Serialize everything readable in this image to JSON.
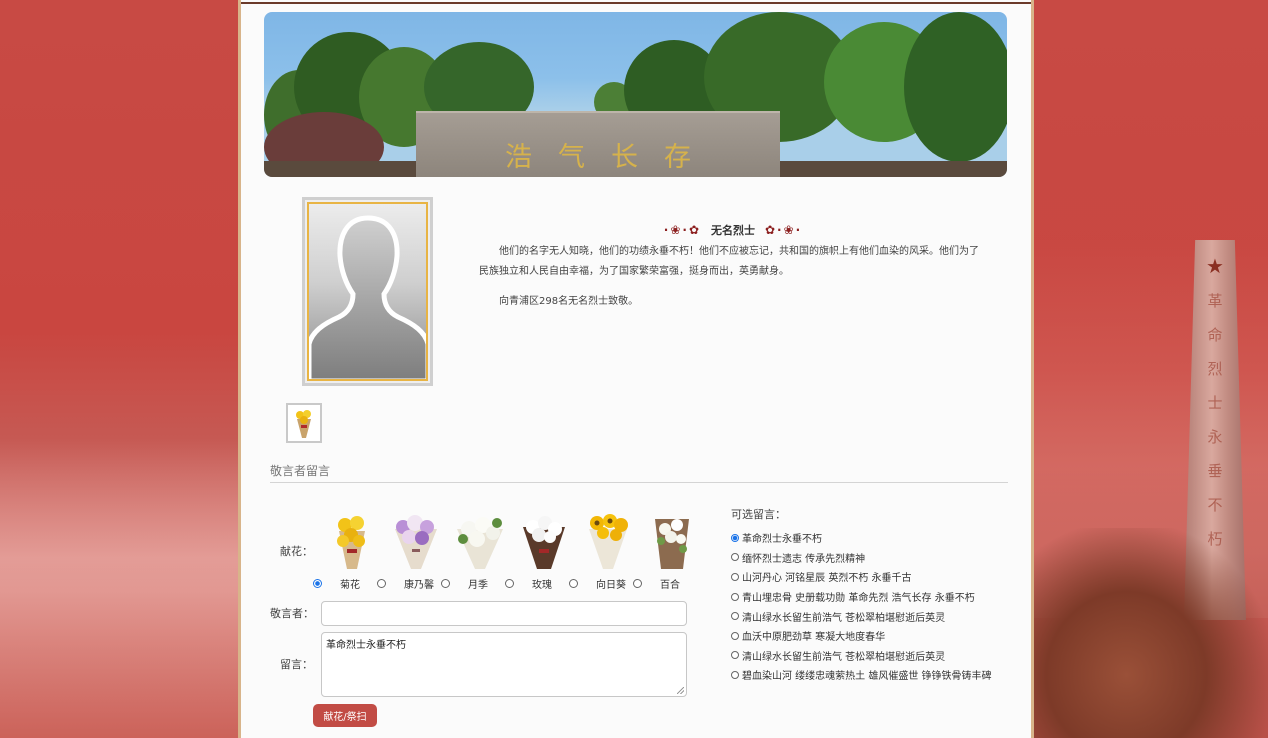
{
  "banner": {
    "inscription": "浩气长存"
  },
  "profile": {
    "name": "无名烈士",
    "bio": "他们的名字无人知晓，他们的功绩永垂不朽！他们不应被忘记，共和国的旗帜上有他们血染的风采。他们为了民族独立和人民自由幸福，为了国家繁荣富强，挺身而出，英勇献身。",
    "tribute": "向青浦区298名无名烈士致敬。"
  },
  "memorial_section": {
    "title": "敬言者留言"
  },
  "form": {
    "flower_label": "献花：",
    "flowers": [
      {
        "label": "菊花",
        "selected": true
      },
      {
        "label": "康乃馨",
        "selected": false
      },
      {
        "label": "月季",
        "selected": false
      },
      {
        "label": "玫瑰",
        "selected": false
      },
      {
        "label": "向日葵",
        "selected": false
      },
      {
        "label": "百合",
        "selected": false
      }
    ],
    "name_label": "敬言者：",
    "name_value": "",
    "message_label": "留言：",
    "message_value": "革命烈士永垂不朽",
    "submit_label": "献花/祭扫"
  },
  "optional_messages": {
    "title": "可选留言：",
    "items": [
      {
        "text": "革命烈士永垂不朽",
        "selected": true
      },
      {
        "text": "缅怀烈士遗志 传承先烈精神",
        "selected": false
      },
      {
        "text": "山河丹心 河铭星辰 英烈不朽 永垂千古",
        "selected": false
      },
      {
        "text": "青山埋忠骨 史册载功勋 革命先烈 浩气长存 永垂不朽",
        "selected": false
      },
      {
        "text": "清山绿水长留生前浩气 苍松翠柏堪慰逝后英灵",
        "selected": false
      },
      {
        "text": "血沃中原肥劲草 寒凝大地度春华",
        "selected": false
      },
      {
        "text": "清山绿水长留生前浩气 苍松翠柏堪慰逝后英灵",
        "selected": false
      },
      {
        "text": "碧血染山河 缕缕忠魂萦热土 雄风催盛世 铮铮铁骨铸丰碑",
        "selected": false
      }
    ]
  },
  "colors": {
    "accent": "#c24c45",
    "background": "#c9463f",
    "frame": "#e8b444"
  }
}
